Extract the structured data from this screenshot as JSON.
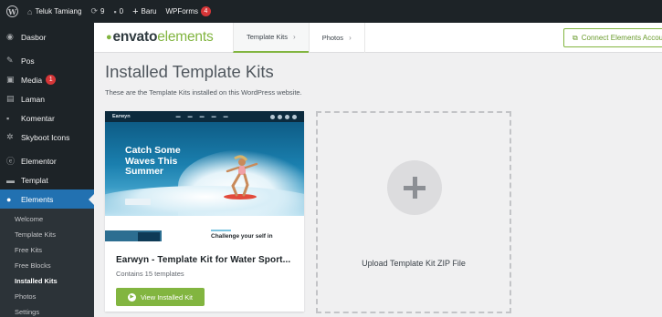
{
  "admin_bar": {
    "site_name": "Teluk Tamiang",
    "updates_count": "9",
    "comments_count": "0",
    "new_label": "Baru",
    "wpforms_label": "WPForms",
    "wpforms_badge": "4"
  },
  "sidebar": {
    "items": [
      {
        "label": "Dasbor",
        "icon": "dashboard-icon"
      },
      {
        "label": "Pos",
        "icon": "pin-icon"
      },
      {
        "label": "Media",
        "icon": "media-icon",
        "badge": "1"
      },
      {
        "label": "Laman",
        "icon": "page-icon"
      },
      {
        "label": "Komentar",
        "icon": "comment-icon"
      },
      {
        "label": "Skyboot Icons",
        "icon": "gear-icon"
      },
      {
        "label": "Elementor",
        "icon": "elementor-icon"
      },
      {
        "label": "Templat",
        "icon": "folder-icon"
      },
      {
        "label": "Elements",
        "icon": "leaf-icon",
        "active": true
      }
    ],
    "submenu": [
      "Welcome",
      "Template Kits",
      "Free Kits",
      "Free Blocks",
      "Installed Kits",
      "Photos",
      "Settings"
    ],
    "current_submenu": "Installed Kits"
  },
  "envato": {
    "logo_main": "envato",
    "logo_suffix": "elements",
    "tabs": [
      "Template Kits",
      "Photos"
    ],
    "active_tab": "Template Kits",
    "connect_button": "Connect Elements Account"
  },
  "main": {
    "title": "Installed Template Kits",
    "description": "These are the Template Kits installed on this WordPress website."
  },
  "kit_card": {
    "name": "Earwyn - Template Kit for Water Sport...",
    "count": "Contains 15 templates",
    "button": "View Installed Kit",
    "preview": {
      "brand": "Earwyn",
      "hero_title": "Catch Some Waves This Summer",
      "section_heading": "Challenge your self in"
    }
  },
  "upload_card": {
    "label": "Upload Template Kit ZIP File"
  },
  "colors": {
    "accent_green": "#82b540",
    "admin_dark": "#1d2327",
    "wp_blue": "#2271b1",
    "badge_red": "#d63638"
  }
}
